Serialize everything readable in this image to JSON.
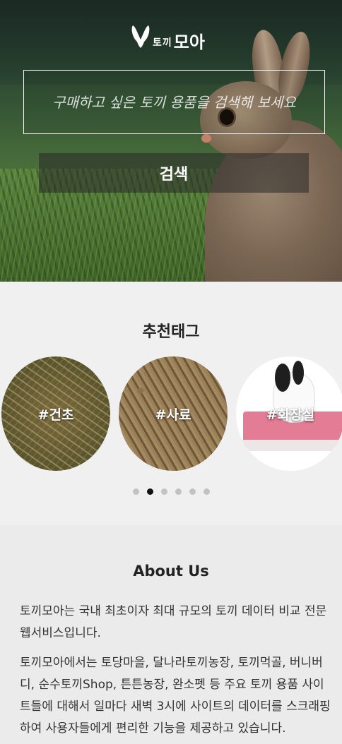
{
  "header": {
    "logo_small": "토끼",
    "logo_big": "모아",
    "search_placeholder": "구매하고 싶은 토끼 용품을 검색해 보세요",
    "search_button": "검색"
  },
  "tags": {
    "title": "추천태그",
    "items": [
      {
        "label": "#건초"
      },
      {
        "label": "#사료"
      },
      {
        "label": "#화장실"
      }
    ],
    "page_count": 6,
    "active_page": 1
  },
  "about": {
    "title": "About Us",
    "paragraphs": [
      " 토끼모아는 국내 최초이자 최대 규모의 토끼 데이터 비교 전문 웹서비스입니다.",
      " 토끼모아에서는 토당마을, 달나라토끼농장, 토끼먹골, 버니버디, 순수토끼Shop, 튼튼농장, 완소펫 등 주요 토끼 용품 사이트들에 대해서 일마다 새벽 3시에 사이트의 데이터를 스크래핑하여 사용자들에게 편리한 기능을 제공하고 있습니다."
    ]
  }
}
